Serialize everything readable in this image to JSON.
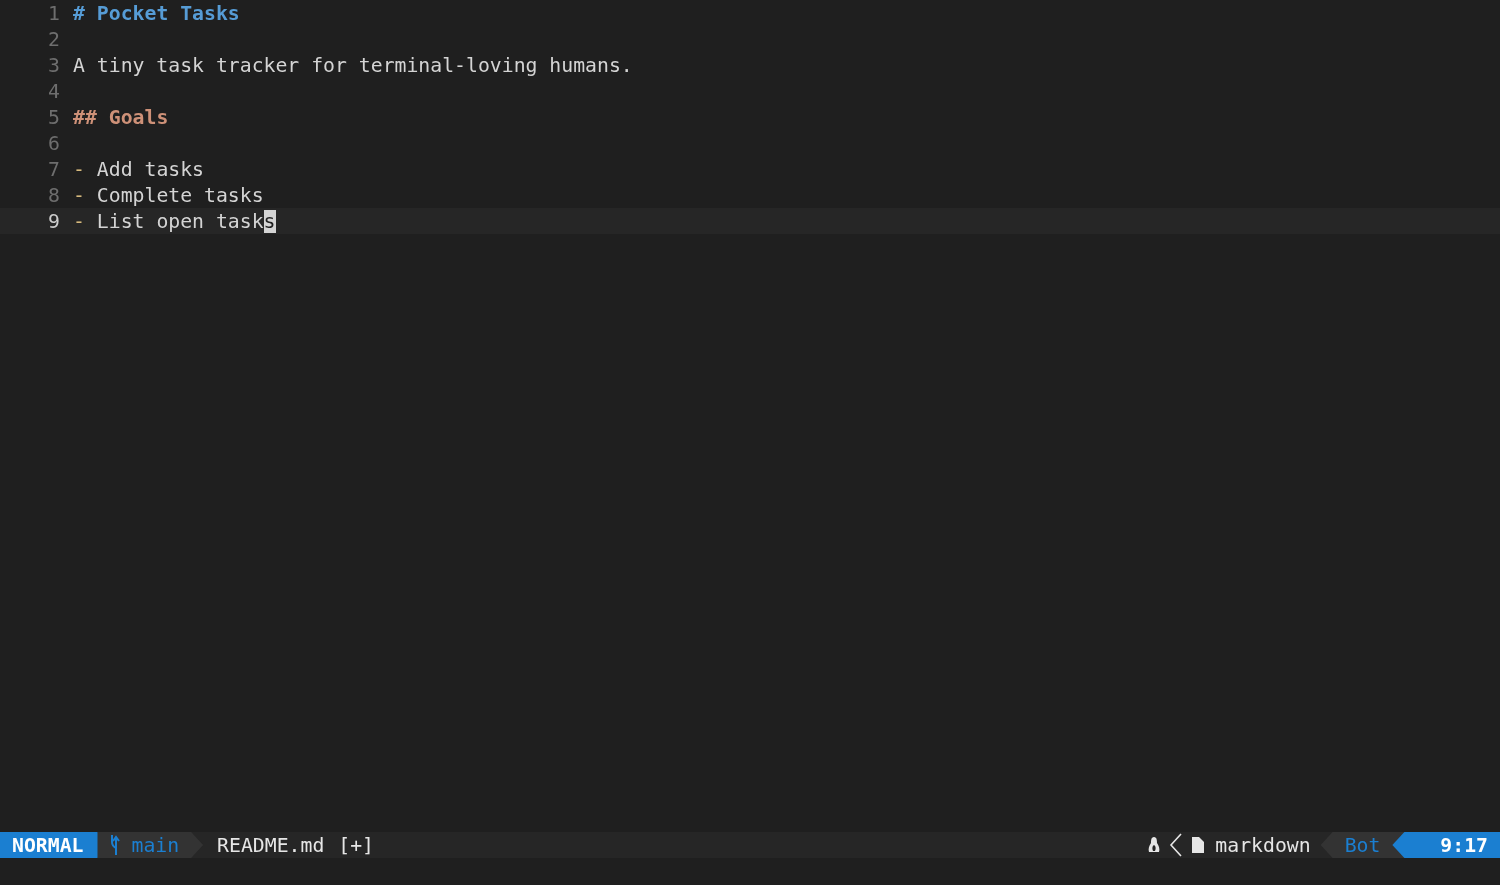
{
  "buffer": {
    "lines": [
      {
        "number": "1",
        "kind": "heading1",
        "marker": "#",
        "text": "Pocket Tasks",
        "current": false
      },
      {
        "number": "2",
        "kind": "blank",
        "current": false
      },
      {
        "number": "3",
        "kind": "text",
        "text": "A tiny task tracker for terminal-loving humans.",
        "current": false
      },
      {
        "number": "4",
        "kind": "blank",
        "current": false
      },
      {
        "number": "5",
        "kind": "heading2",
        "marker": "##",
        "text": "Goals",
        "current": false
      },
      {
        "number": "6",
        "kind": "blank",
        "current": false
      },
      {
        "number": "7",
        "kind": "list",
        "marker": "-",
        "text": "Add tasks",
        "current": false
      },
      {
        "number": "8",
        "kind": "list",
        "marker": "-",
        "text": "Complete tasks",
        "current": false
      },
      {
        "number": "9",
        "kind": "list",
        "marker": "-",
        "text": "List open task",
        "cursor_char": "s",
        "current": true
      }
    ]
  },
  "status_bar": {
    "mode": "NORMAL",
    "branch": "main",
    "file": "README.md",
    "modified": "[+]",
    "filetype": "markdown",
    "position": "Bot",
    "cursor": "9:17"
  }
}
